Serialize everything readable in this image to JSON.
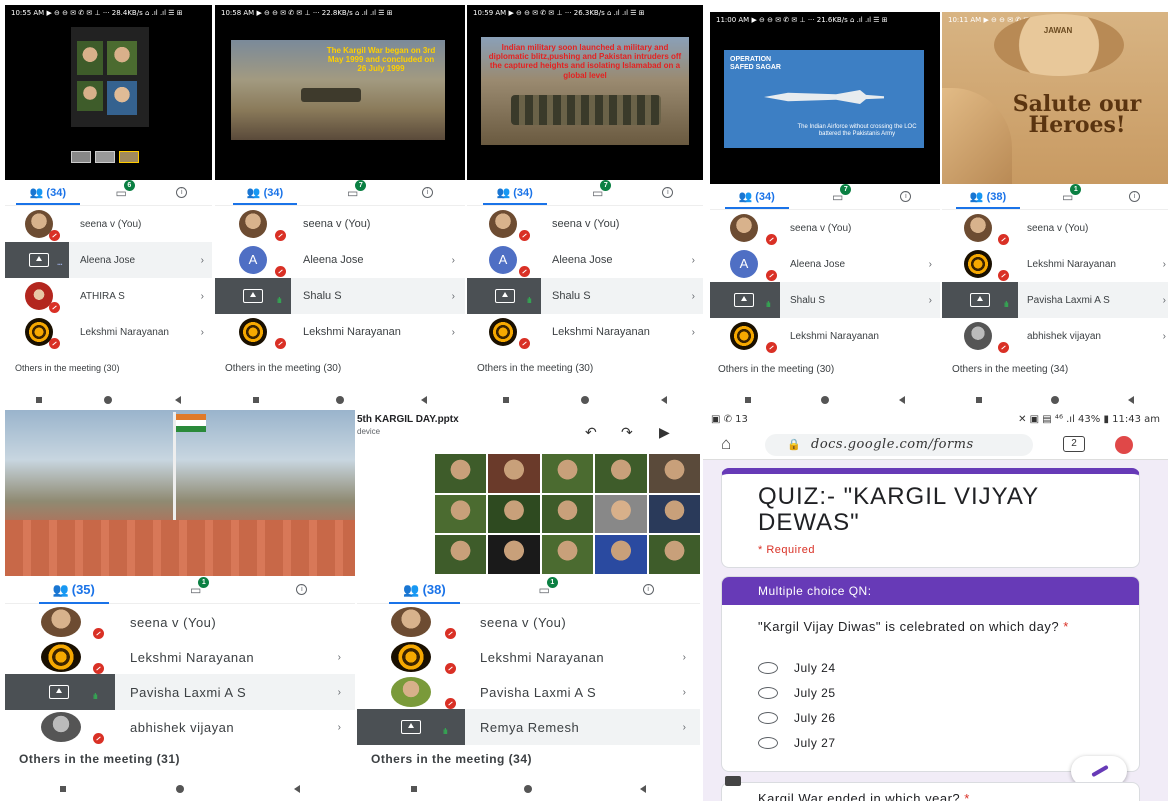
{
  "panels": [
    {
      "status": "10:55 AM ▶ ⊖ ⊖ ✉ ✆ ✉ ⊥ ··· 28.4KB/s ⌂ .ıl .ıl ☰ ⊞",
      "participants_count": "(34)",
      "chat_badge": "6",
      "rows": [
        {
          "name": "seena v (You)"
        },
        {
          "name": "Aleena Jose"
        },
        {
          "name": "ATHIRA S"
        },
        {
          "name": "Lekshmi Narayanan"
        }
      ],
      "others": "Others in the meeting (30)"
    },
    {
      "status": "10:58 AM ▶ ⊖ ⊖ ✉ ✆ ✉ ⊥ ··· 22.8KB/s ⌂ .ıl .ıl ☰ ⊞",
      "slide_text": "The Kargil War began on 3rd May 1999 and concluded on 26 July 1999",
      "participants_count": "(34)",
      "chat_badge": "7",
      "rows": [
        {
          "name": "seena v (You)"
        },
        {
          "name": "Aleena Jose",
          "letter": "A"
        },
        {
          "name": "Shalu S"
        },
        {
          "name": "Lekshmi Narayanan"
        }
      ],
      "others": "Others in the meeting (30)"
    },
    {
      "status": "10:59 AM ▶ ⊖ ⊖ ✉ ✆ ✉ ⊥ ··· 26.3KB/s ⌂ .ıl .ıl ☰ ⊞",
      "slide_text": "Indian military soon launched a military and diplomatic blitz,pushing and Pakistan intruders off the captured heights and isolating Islamabad on a global level",
      "participants_count": "(34)",
      "chat_badge": "7",
      "rows": [
        {
          "name": "seena v (You)"
        },
        {
          "name": "Aleena Jose",
          "letter": "A"
        },
        {
          "name": "Shalu S"
        },
        {
          "name": "Lekshmi Narayanan"
        }
      ],
      "others": "Others in the meeting (30)"
    },
    {
      "status": "11:00 AM ▶ ⊖ ⊖ ✉ ✆ ✉ ⊥ ··· 21.6KB/s ⌂ .ıl .ıl ☰ ⊞",
      "slide_title": "OPERATION SAFED SAGAR",
      "slide_text": "The Indian Airforce without crossing the LOC battered the Pakistanis Army",
      "participants_count": "(34)",
      "chat_badge": "7",
      "rows": [
        {
          "name": "seena v (You)"
        },
        {
          "name": "Aleena Jose",
          "letter": "A"
        },
        {
          "name": "Shalu S"
        },
        {
          "name": "Lekshmi Narayanan"
        }
      ],
      "others": "Others in the meeting (30)"
    },
    {
      "status": "10:11 AM ▶ ⊖ ⊖ ✉ ✆ ✉ ⊥ ··· 21.9KB/s",
      "slide_label": "JAWAN",
      "slide_text": "Salute our Heroes!",
      "participants_count": "(38)",
      "chat_badge": "1",
      "rows": [
        {
          "name": "seena v (You)"
        },
        {
          "name": "Lekshmi Narayanan"
        },
        {
          "name": "Pavisha Laxmi A S"
        },
        {
          "name": "abhishek vijayan"
        }
      ],
      "others": "Others in the meeting (34)"
    },
    {
      "participants_count": "(35)",
      "chat_badge": "1",
      "rows": [
        {
          "name": "seena v (You)"
        },
        {
          "name": "Lekshmi Narayanan"
        },
        {
          "name": "Pavisha Laxmi A S"
        },
        {
          "name": "abhishek vijayan"
        }
      ],
      "others": "Others in the meeting (31)"
    },
    {
      "file_title": "5th KARGIL DAY.pptx",
      "file_sub": "device",
      "participants_count": "(38)",
      "chat_badge": "1",
      "rows": [
        {
          "name": "seena v (You)"
        },
        {
          "name": "Lekshmi Narayanan"
        },
        {
          "name": "Pavisha Laxmi A S"
        },
        {
          "name": "Remya Remesh"
        }
      ],
      "others": "Others in the meeting (34)"
    }
  ],
  "form": {
    "status_left": "▣ ✆ 13",
    "status_right": "✕ ▣ ▤ ⁴⁶ .ıl 43% ▮ 11:43 am",
    "url": "docs.google.com/forms",
    "tab_count": "2",
    "title": "QUIZ:- \"KARGIL VIJYAY DEWAS\"",
    "required": "* Required",
    "section": "Multiple choice QN:",
    "question": "\"Kargil Vijay Diwas\" is celebrated on which day?",
    "question_star": "*",
    "options": [
      "July 24",
      "July 25",
      "July 26",
      "July 27"
    ],
    "next_question": "Kargil War ended in which year?",
    "next_star": "*"
  },
  "colors": {
    "accent": "#1a73e8",
    "form_purple": "#673ab7",
    "mute_red": "#d93025",
    "speaking_green": "#34a853"
  }
}
